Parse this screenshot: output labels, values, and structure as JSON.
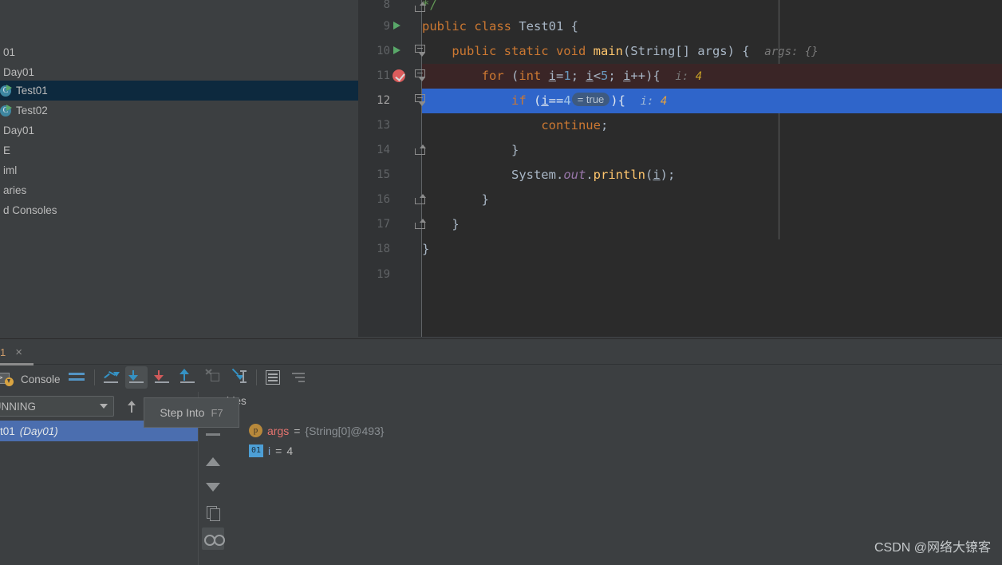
{
  "project_tree": {
    "items": [
      {
        "label": "01",
        "icon": "none",
        "selected": false,
        "indent": 0
      },
      {
        "label": "Day01",
        "icon": "none",
        "selected": false,
        "indent": 0
      },
      {
        "label": "Test01",
        "icon": "java-class",
        "selected": true,
        "indent": 14
      },
      {
        "label": "Test02",
        "icon": "java-class",
        "selected": false,
        "indent": 14
      },
      {
        "label": "Day01",
        "icon": "none",
        "selected": false,
        "indent": 0
      },
      {
        "label": "E",
        "icon": "none",
        "selected": false,
        "indent": 0
      },
      {
        "label": "iml",
        "icon": "none",
        "selected": false,
        "indent": 0
      },
      {
        "label": "aries",
        "icon": "none",
        "selected": false,
        "indent": 0
      },
      {
        "label": "d Consoles",
        "icon": "none",
        "selected": false,
        "indent": 0
      }
    ]
  },
  "editor": {
    "lines": [
      {
        "num": "8",
        "gutter": "fold-end",
        "text": "*/",
        "style": "comment",
        "hl": "none"
      },
      {
        "num": "9",
        "gutter": "run",
        "text": "public class Test01 {",
        "hl": "none"
      },
      {
        "num": "10",
        "gutter": "run-fold",
        "text": "public static void main(String[] args) {",
        "hint": "args:",
        "hint_value": "{}",
        "hl": "none"
      },
      {
        "num": "11",
        "gutter": "breakpoint",
        "text": "for (int i=1; i<5; i++){",
        "hint": "i:",
        "hint_value": "4",
        "hl": "breakpoint"
      },
      {
        "num": "12",
        "gutter": "fold",
        "text": "if (i==4 = true ){",
        "hint": "i:",
        "hint_value": "4",
        "hl": "execution"
      },
      {
        "num": "13",
        "gutter": "none",
        "text": "continue;",
        "hl": "none"
      },
      {
        "num": "14",
        "gutter": "fold-end",
        "text": "}",
        "hl": "none"
      },
      {
        "num": "15",
        "gutter": "none",
        "text": "System.out.println(i);",
        "hl": "none"
      },
      {
        "num": "16",
        "gutter": "fold-end",
        "text": "}",
        "hl": "none"
      },
      {
        "num": "17",
        "gutter": "fold-end",
        "text": "}",
        "hl": "none"
      },
      {
        "num": "18",
        "gutter": "none",
        "text": "}",
        "hl": "none"
      },
      {
        "num": "19",
        "gutter": "none",
        "text": "",
        "hl": "none"
      }
    ],
    "inline_hint_true": "= true"
  },
  "debug_panel": {
    "tab": {
      "number": "1",
      "close": "×"
    },
    "console_button": {
      "label": "Console"
    },
    "toolbar_buttons": [
      {
        "name": "show-execution-point",
        "tip": "Show Execution Point"
      },
      {
        "name": "step-over",
        "tip": "Step Over"
      },
      {
        "name": "step-into",
        "tip": "Step Into",
        "active": true
      },
      {
        "name": "force-step-into",
        "tip": "Force Step Into"
      },
      {
        "name": "step-out",
        "tip": "Step Out"
      },
      {
        "name": "drop-frame",
        "tip": "Drop Frame"
      },
      {
        "name": "run-to-cursor",
        "tip": "Run to Cursor"
      },
      {
        "name": "evaluate-expression",
        "tip": "Evaluate Expression"
      },
      {
        "name": "settings",
        "tip": "Settings"
      }
    ],
    "tooltip": {
      "name": "Step Into",
      "shortcut": "F7"
    },
    "frames": {
      "thread_selector": "i...n\": RUNNING",
      "rows": [
        {
          "method": "t01",
          "location": "(Day01)",
          "selected": true
        }
      ]
    },
    "variables": {
      "title": "bles",
      "rows": [
        {
          "icon": "p",
          "name": "args",
          "eq": "=",
          "value": "{String[0]@493}",
          "value_kind": "ref"
        },
        {
          "icon": "01",
          "name": "i",
          "eq": "=",
          "value": "4",
          "value_kind": "num"
        }
      ]
    }
  },
  "watermark": {
    "text": "CSDN @网络大镣客"
  },
  "colors": {
    "editor_bg": "#2b2b2b",
    "gutter_bg": "#313335",
    "panel_bg": "#3c3f41",
    "exec_line": "#2f65ca",
    "breakpoint_line": "#3a2526",
    "selection_blue": "#4b6eaf",
    "keyword": "#cc7832",
    "number": "#6897bb",
    "text": "#a9b7c6",
    "static_field": "#9876aa"
  }
}
